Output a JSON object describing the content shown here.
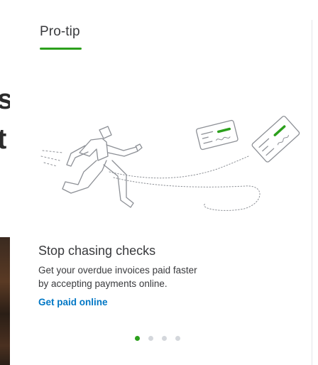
{
  "background": {
    "partial_glyph_1": "s",
    "partial_glyph_2": "t"
  },
  "card": {
    "title": "Pro-tip",
    "headline": "Stop chasing checks",
    "body_line_1": "Get your overdue invoices paid faster",
    "body_line_2": "by accepting payments online.",
    "cta_label": "Get paid online",
    "illustration_icon": "running-person-chasing-checks-illustration"
  },
  "pagination": {
    "total": 4,
    "active_index": 0
  },
  "colors": {
    "accent": "#2ca01c",
    "link": "#0077c5",
    "text": "#393a3d",
    "inactive_dot": "#d4d7dc"
  }
}
